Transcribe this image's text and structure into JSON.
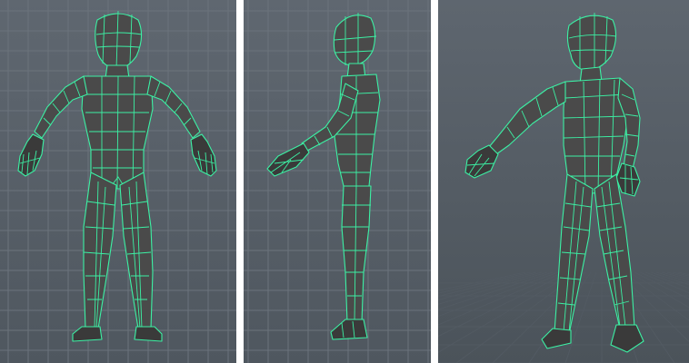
{
  "viewports": [
    {
      "id": "front",
      "label": "",
      "background": "#5c656e",
      "mesh_color": "#3cf0a4"
    },
    {
      "id": "side",
      "label": "",
      "background": "#5c656e",
      "mesh_color": "#3cf0a4"
    },
    {
      "id": "perspective",
      "label": "",
      "background": "#5a636c",
      "mesh_color": "#3cf0a4"
    }
  ],
  "divider_color": "#ffffff",
  "grid_color": "#6b737c"
}
